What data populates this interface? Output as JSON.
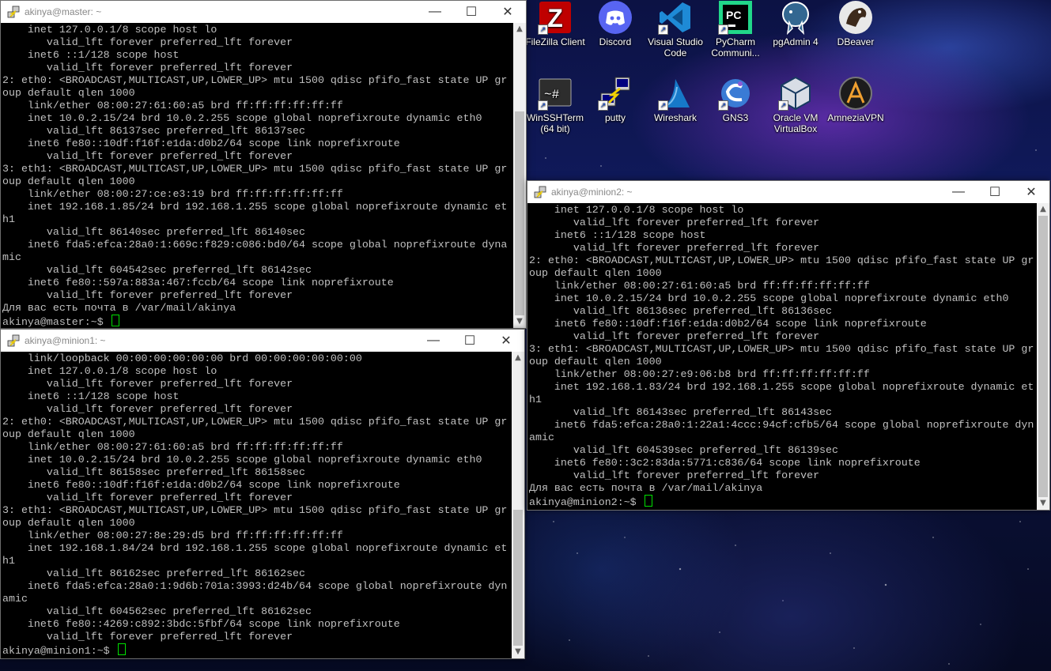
{
  "desktop": {
    "icons": [
      {
        "label": "FileZilla Client",
        "icon": "filezilla-icon",
        "color": "#bf0000"
      },
      {
        "label": "Discord",
        "icon": "discord-icon",
        "color": "#5865f2"
      },
      {
        "label": "Visual Studio Code",
        "icon": "vscode-icon",
        "color": "#1e8ad6"
      },
      {
        "label": "PyCharm Communi...",
        "icon": "pycharm-icon",
        "color": "#21d789"
      },
      {
        "label": "pgAdmin 4",
        "icon": "pgadmin-icon",
        "color": "#336791"
      },
      {
        "label": "DBeaver",
        "icon": "dbeaver-icon",
        "color": "#3d2a1b"
      },
      {
        "label": "WinSSHTerm (64 bit)",
        "icon": "winsshterm-icon",
        "color": "#333333"
      },
      {
        "label": "putty",
        "icon": "putty-icon",
        "color": "#e8d000"
      },
      {
        "label": "Wireshark",
        "icon": "wireshark-icon",
        "color": "#1679c9"
      },
      {
        "label": "GNS3",
        "icon": "gns3-icon",
        "color": "#3a7bd5"
      },
      {
        "label": "Oracle VM VirtualBox",
        "icon": "virtualbox-icon",
        "color": "#183a61"
      },
      {
        "label": "AmneziaVPN",
        "icon": "amneziavpn-icon",
        "color": "#f0a030"
      }
    ]
  },
  "windows": {
    "master": {
      "title": "akinya@master: ~",
      "lines": [
        "    inet 127.0.0.1/8 scope host lo",
        "       valid_lft forever preferred_lft forever",
        "    inet6 ::1/128 scope host",
        "       valid_lft forever preferred_lft forever",
        "2: eth0: <BROADCAST,MULTICAST,UP,LOWER_UP> mtu 1500 qdisc pfifo_fast state UP gr",
        "oup default qlen 1000",
        "    link/ether 08:00:27:61:60:a5 brd ff:ff:ff:ff:ff:ff",
        "    inet 10.0.2.15/24 brd 10.0.2.255 scope global noprefixroute dynamic eth0",
        "       valid_lft 86137sec preferred_lft 86137sec",
        "    inet6 fe80::10df:f16f:e1da:d0b2/64 scope link noprefixroute",
        "       valid_lft forever preferred_lft forever",
        "3: eth1: <BROADCAST,MULTICAST,UP,LOWER_UP> mtu 1500 qdisc pfifo_fast state UP gr",
        "oup default qlen 1000",
        "    link/ether 08:00:27:ce:e3:19 brd ff:ff:ff:ff:ff:ff",
        "    inet 192.168.1.85/24 brd 192.168.1.255 scope global noprefixroute dynamic et",
        "h1",
        "       valid_lft 86140sec preferred_lft 86140sec",
        "    inet6 fda5:efca:28a0:1:669c:f829:c086:bd0/64 scope global noprefixroute dyna",
        "mic",
        "       valid_lft 604542sec preferred_lft 86142sec",
        "    inet6 fe80::597a:883a:467:fccb/64 scope link noprefixroute",
        "       valid_lft forever preferred_lft forever",
        "Для вас есть почта в /var/mail/akinya"
      ],
      "prompt": "akinya@master:~$ "
    },
    "minion1": {
      "title": "akinya@minion1: ~",
      "lines": [
        "    link/loopback 00:00:00:00:00:00 brd 00:00:00:00:00:00",
        "    inet 127.0.0.1/8 scope host lo",
        "       valid_lft forever preferred_lft forever",
        "    inet6 ::1/128 scope host",
        "       valid_lft forever preferred_lft forever",
        "2: eth0: <BROADCAST,MULTICAST,UP,LOWER_UP> mtu 1500 qdisc pfifo_fast state UP gr",
        "oup default qlen 1000",
        "    link/ether 08:00:27:61:60:a5 brd ff:ff:ff:ff:ff:ff",
        "    inet 10.0.2.15/24 brd 10.0.2.255 scope global noprefixroute dynamic eth0",
        "       valid_lft 86158sec preferred_lft 86158sec",
        "    inet6 fe80::10df:f16f:e1da:d0b2/64 scope link noprefixroute",
        "       valid_lft forever preferred_lft forever",
        "3: eth1: <BROADCAST,MULTICAST,UP,LOWER_UP> mtu 1500 qdisc pfifo_fast state UP gr",
        "oup default qlen 1000",
        "    link/ether 08:00:27:8e:29:d5 brd ff:ff:ff:ff:ff:ff",
        "    inet 192.168.1.84/24 brd 192.168.1.255 scope global noprefixroute dynamic et",
        "h1",
        "       valid_lft 86162sec preferred_lft 86162sec",
        "    inet6 fda5:efca:28a0:1:9d6b:701a:3993:d24b/64 scope global noprefixroute dyn",
        "amic",
        "       valid_lft 604562sec preferred_lft 86162sec",
        "    inet6 fe80::4269:c892:3bdc:5fbf/64 scope link noprefixroute",
        "       valid_lft forever preferred_lft forever"
      ],
      "prompt": "akinya@minion1:~$ "
    },
    "minion2": {
      "title": "akinya@minion2: ~",
      "lines": [
        "    inet 127.0.0.1/8 scope host lo",
        "       valid_lft forever preferred_lft forever",
        "    inet6 ::1/128 scope host",
        "       valid_lft forever preferred_lft forever",
        "2: eth0: <BROADCAST,MULTICAST,UP,LOWER_UP> mtu 1500 qdisc pfifo_fast state UP gr",
        "oup default qlen 1000",
        "    link/ether 08:00:27:61:60:a5 brd ff:ff:ff:ff:ff:ff",
        "    inet 10.0.2.15/24 brd 10.0.2.255 scope global noprefixroute dynamic eth0",
        "       valid_lft 86136sec preferred_lft 86136sec",
        "    inet6 fe80::10df:f16f:e1da:d0b2/64 scope link noprefixroute",
        "       valid_lft forever preferred_lft forever",
        "3: eth1: <BROADCAST,MULTICAST,UP,LOWER_UP> mtu 1500 qdisc pfifo_fast state UP gr",
        "oup default qlen 1000",
        "    link/ether 08:00:27:e9:06:b8 brd ff:ff:ff:ff:ff:ff",
        "    inet 192.168.1.83/24 brd 192.168.1.255 scope global noprefixroute dynamic et",
        "h1",
        "       valid_lft 86143sec preferred_lft 86143sec",
        "    inet6 fda5:efca:28a0:1:22a1:4ccc:94cf:cfb5/64 scope global noprefixroute dyn",
        "amic",
        "       valid_lft 604539sec preferred_lft 86139sec",
        "    inet6 fe80::3c2:83da:5771:c836/64 scope link noprefixroute",
        "       valid_lft forever preferred_lft forever",
        "Для вас есть почта в /var/mail/akinya"
      ],
      "prompt": "akinya@minion2:~$ "
    }
  },
  "titlebar_buttons": {
    "minimize": "—",
    "maximize": "☐",
    "close": "✕"
  },
  "scroll_arrows": {
    "up": "▲",
    "down": "▼"
  }
}
